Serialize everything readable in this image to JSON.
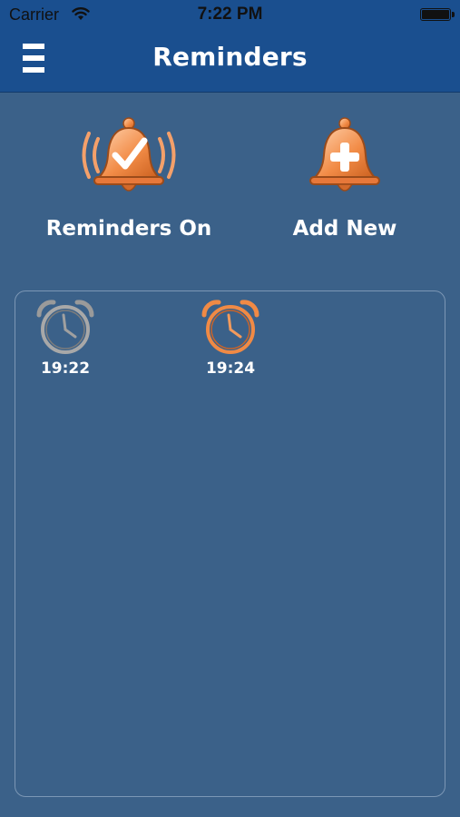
{
  "status_bar": {
    "carrier": "Carrier",
    "time": "7:22 PM",
    "wifi_icon": "wifi-icon",
    "battery_icon": "battery-icon"
  },
  "nav": {
    "title": "Reminders",
    "menu_icon": "hamburger-menu-icon"
  },
  "actions": [
    {
      "label": "Reminders On",
      "icon": "bell-check-icon"
    },
    {
      "label": "Add New",
      "icon": "bell-plus-icon"
    }
  ],
  "reminders": [
    {
      "time": "19:22",
      "state": "inactive",
      "icon": "alarm-clock-gray-icon"
    },
    {
      "time": "19:24",
      "state": "active",
      "icon": "alarm-clock-orange-icon"
    }
  ],
  "colors": {
    "nav_background": "#1a4f8f",
    "page_background": "#3b6189",
    "accent_orange": "#f08a45",
    "inactive_gray": "#9a9a9a"
  }
}
